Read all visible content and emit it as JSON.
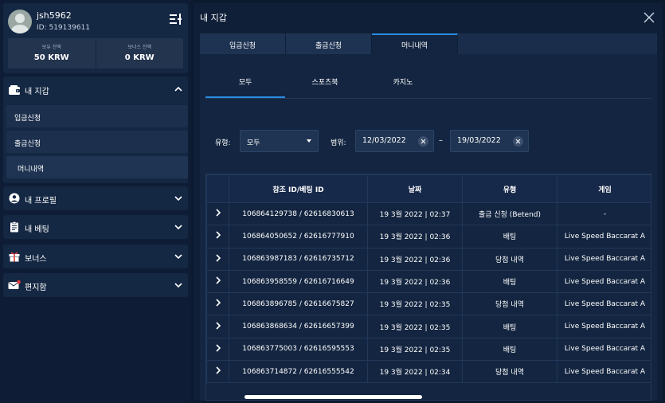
{
  "sidebar": {
    "username": "jsh5962",
    "user_id": "ID: 519139611",
    "balance_label": "보유 잔액",
    "balance_value": "50 KRW",
    "bonus_label": "보너스 잔액",
    "bonus_value": "0 KRW",
    "wallet": {
      "label": "내 지갑",
      "items": [
        {
          "label": "입금신청"
        },
        {
          "label": "출금신청"
        },
        {
          "label": "머니내역"
        }
      ]
    },
    "nav": [
      {
        "label": "내 프로필",
        "icon": "user-icon"
      },
      {
        "label": "내 베팅",
        "icon": "clipboard-icon"
      },
      {
        "label": "보너스",
        "icon": "gift-icon"
      },
      {
        "label": "편지함",
        "icon": "mail-icon"
      }
    ]
  },
  "main": {
    "title": "내 지갑",
    "top_tabs": [
      {
        "label": "입금신청"
      },
      {
        "label": "출금신청"
      },
      {
        "label": "머니내역"
      }
    ],
    "active_top_tab": "머니내역",
    "sub_tabs": [
      {
        "label": "모두"
      },
      {
        "label": "스포츠북"
      },
      {
        "label": "카지노"
      }
    ],
    "active_sub_tab": "모두",
    "filters": {
      "type_label": "유형:",
      "type_value": "모두",
      "range_label": "범위:",
      "date_from": "12/03/2022",
      "date_separator": "–",
      "date_to": "19/03/2022"
    },
    "table": {
      "headers": [
        "참조 ID/베팅 ID",
        "날짜",
        "유형",
        "게임"
      ],
      "rows": [
        [
          "106864129738 / 62616830613",
          "19 3월 2022 | 02:37",
          "출금 신청 (Betend)",
          "-"
        ],
        [
          "106864050652 / 62616777910",
          "19 3월 2022 | 02:36",
          "배팅",
          "Live Speed Baccarat A"
        ],
        [
          "106863987183 / 62616735712",
          "19 3월 2022 | 02:36",
          "당첨 내역",
          "Live Speed Baccarat A"
        ],
        [
          "106863958559 / 62616716649",
          "19 3월 2022 | 02:36",
          "배팅",
          "Live Speed Baccarat A"
        ],
        [
          "106863896785 / 62616675827",
          "19 3월 2022 | 02:35",
          "당첨 내역",
          "Live Speed Baccarat A"
        ],
        [
          "106863868634 / 62616657399",
          "19 3월 2022 | 02:35",
          "배팅",
          "Live Speed Baccarat A"
        ],
        [
          "106863775003 / 62616595553",
          "19 3월 2022 | 02:35",
          "배팅",
          "Live Speed Baccarat A"
        ],
        [
          "106863714872 / 62616555542",
          "19 3월 2022 | 02:34",
          "당첨 내역",
          "Live Speed Baccarat A"
        ]
      ]
    }
  },
  "colors": {
    "accent": "#2a8be0",
    "background": "#0c1a30",
    "panel": "#132540"
  }
}
